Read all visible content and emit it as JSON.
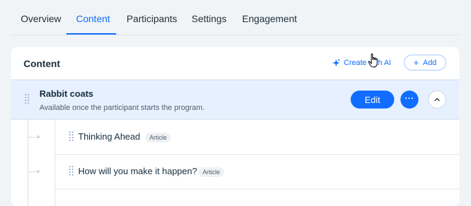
{
  "tabs": [
    {
      "label": "Overview"
    },
    {
      "label": "Content"
    },
    {
      "label": "Participants"
    },
    {
      "label": "Settings"
    },
    {
      "label": "Engagement"
    }
  ],
  "active_tab": "Content",
  "content_card": {
    "title": "Content",
    "create_ai_label": "Create with AI",
    "add_label": "Add",
    "section": {
      "title": "Rabbit coats",
      "subtitle": "Available once the participant starts the program.",
      "edit_label": "Edit",
      "more_icon": "ellipsis-icon",
      "collapse_icon": "chevron-up-icon"
    },
    "steps": [
      {
        "title": "Thinking Ahead",
        "type": "Article"
      },
      {
        "title": "How will you make it happen?",
        "type": "Article"
      }
    ]
  },
  "colors": {
    "accent": "#116dff",
    "highlight_row": "#e7f0ff",
    "page_bg": "#f0f4f7",
    "text_primary": "#162d3d"
  }
}
